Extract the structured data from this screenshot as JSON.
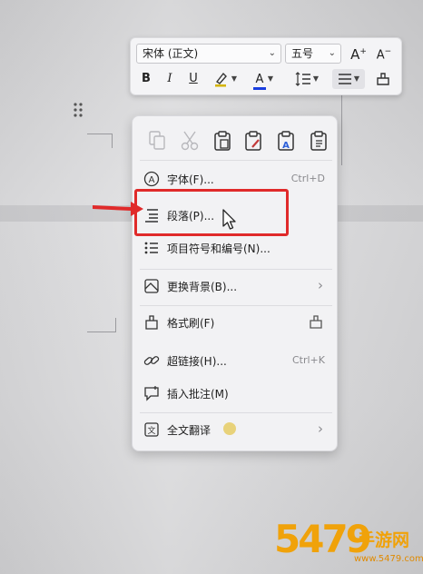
{
  "toolbar": {
    "font_name": "宋体 (正文)",
    "font_size": "五号",
    "grow_label": "A",
    "shrink_label": "A",
    "bold_label": "B",
    "italic_label": "I",
    "underline_label": "U",
    "font_color_label": "A",
    "font_color": "#1a3ee0",
    "highlight_color": "#d4b400"
  },
  "menu": {
    "clipboard_icons": [
      "copy-icon",
      "cut-icon",
      "paste-icon",
      "paste-keep-format-icon",
      "paste-text-icon",
      "paste-special-icon"
    ],
    "items": [
      {
        "label": "字体(F)...",
        "shortcut": "Ctrl+D",
        "icon": "font-icon"
      },
      {
        "label": "段落(P)...",
        "shortcut": "",
        "icon": "paragraph-icon"
      },
      {
        "label": "项目符号和编号(N)...",
        "shortcut": "",
        "icon": "bullets-icon"
      },
      {
        "label": "更换背景(B)...",
        "shortcut": "",
        "icon": "background-icon",
        "submenu": true
      },
      {
        "label": "格式刷(F)",
        "shortcut": "",
        "icon": "format-painter-icon"
      },
      {
        "label": "超链接(H)...",
        "shortcut": "Ctrl+K",
        "icon": "hyperlink-icon"
      },
      {
        "label": "插入批注(M)",
        "shortcut": "",
        "icon": "comment-icon"
      },
      {
        "label": "全文翻译",
        "shortcut": "",
        "icon": "translate-icon",
        "submenu": true
      }
    ]
  },
  "watermark": {
    "number": "5479",
    "brand": "手游网",
    "domain": "www.5479.com"
  },
  "colors": {
    "highlight_box": "#e02a2a",
    "arrow": "#e02a2a"
  }
}
